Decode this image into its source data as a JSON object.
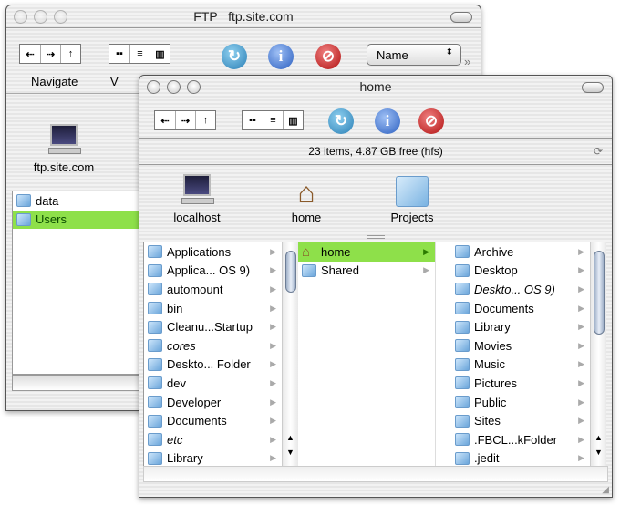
{
  "ftp_window": {
    "title": "FTP   ftp.site.com",
    "toolbar": {
      "navigate_label": "Navigate",
      "view_label": "V",
      "sort_select": "Name"
    },
    "shelf": {
      "server": "ftp.site.com"
    },
    "items": [
      {
        "name": "data"
      },
      {
        "name": "Users",
        "selected": true
      }
    ]
  },
  "home_window": {
    "title": "home",
    "status": "23 items, 4.87 GB free (hfs)",
    "shelf": [
      {
        "label": "localhost",
        "icon": "computer-icon"
      },
      {
        "label": "home",
        "icon": "house-icon"
      },
      {
        "label": "Projects",
        "icon": "folder-icon"
      }
    ],
    "columns": [
      [
        {
          "name": "Applications"
        },
        {
          "name": "Applica... OS 9)"
        },
        {
          "name": "automount"
        },
        {
          "name": "bin"
        },
        {
          "name": "Cleanu...Startup"
        },
        {
          "name": "cores",
          "italic": true
        },
        {
          "name": "Deskto... Folder"
        },
        {
          "name": "dev"
        },
        {
          "name": "Developer"
        },
        {
          "name": "Documents"
        },
        {
          "name": "etc",
          "italic": true
        },
        {
          "name": "Library"
        }
      ],
      [
        {
          "name": "home",
          "selected": true,
          "home": true
        },
        {
          "name": "Shared"
        }
      ],
      [
        {
          "name": "Archive"
        },
        {
          "name": "Desktop"
        },
        {
          "name": "Deskto... OS 9)",
          "italic": true
        },
        {
          "name": "Documents"
        },
        {
          "name": "Library"
        },
        {
          "name": "Movies"
        },
        {
          "name": "Music"
        },
        {
          "name": "Pictures"
        },
        {
          "name": "Public"
        },
        {
          "name": "Sites"
        },
        {
          "name": ".FBCL...kFolder"
        },
        {
          "name": ".jedit"
        }
      ]
    ]
  },
  "colors": {
    "selection": "#8ee04a"
  }
}
